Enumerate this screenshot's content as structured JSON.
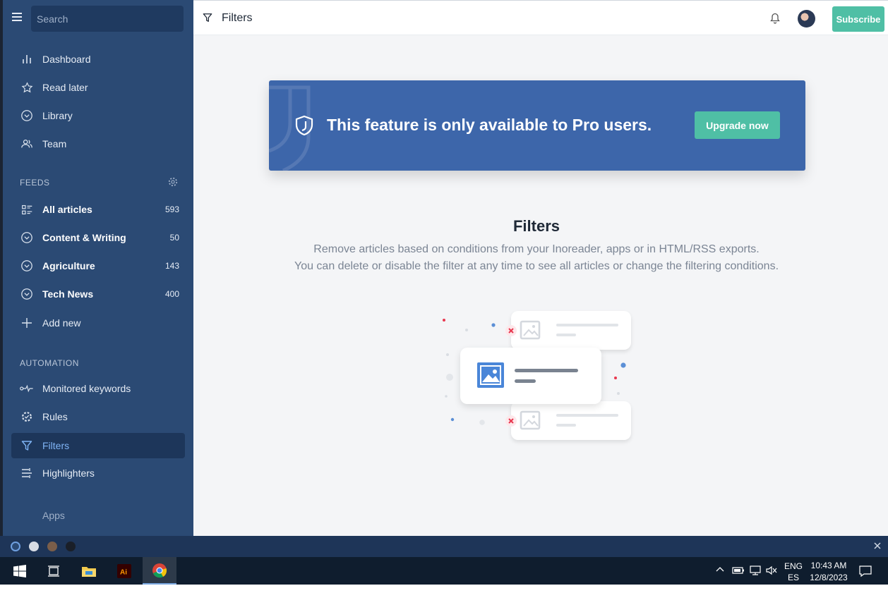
{
  "sidebar": {
    "search_placeholder": "Search",
    "nav": [
      {
        "label": "Dashboard",
        "icon": "bar-chart-icon"
      },
      {
        "label": "Read later",
        "icon": "star-icon"
      },
      {
        "label": "Library",
        "icon": "chevron-circle-icon"
      },
      {
        "label": "Team",
        "icon": "team-icon"
      }
    ],
    "feeds_heading": "FEEDS",
    "feeds": [
      {
        "label": "All articles",
        "count": "593"
      },
      {
        "label": "Content & Writing",
        "count": "50"
      },
      {
        "label": "Agriculture",
        "count": "143"
      },
      {
        "label": "Tech News",
        "count": "400"
      }
    ],
    "add_new": "Add new",
    "automation_heading": "AUTOMATION",
    "automation": [
      {
        "label": "Monitored keywords"
      },
      {
        "label": "Rules"
      },
      {
        "label": "Filters"
      },
      {
        "label": "Highlighters"
      }
    ],
    "apps": "Apps"
  },
  "topbar": {
    "title": "Filters",
    "subscribe": "Subscribe"
  },
  "main": {
    "banner_text": "This feature is only available to Pro users.",
    "upgrade_label": "Upgrade now",
    "title": "Filters",
    "desc_line1": "Remove articles based on conditions from your Inoreader, apps or in HTML/RSS exports.",
    "desc_line2": "You can delete or disable the filter at any time to see all articles or change the filtering conditions."
  },
  "taskbar": {
    "lang1": "ENG",
    "lang2": "ES",
    "time": "10:43 AM",
    "date": "12/8/2023"
  },
  "colors": {
    "sidebar": "#2b4a74",
    "accent": "#4fbfa5",
    "banner": "#3d66aa",
    "active_text": "#7fb4f5"
  }
}
